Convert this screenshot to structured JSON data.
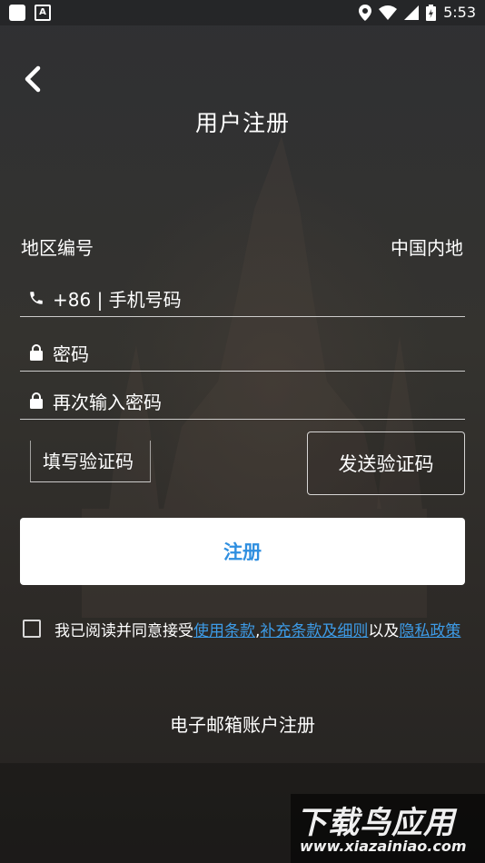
{
  "status_bar": {
    "time": "5:53",
    "icons": [
      "app-icon",
      "font-icon",
      "location-icon",
      "wifi-icon",
      "signal-icon",
      "battery-icon"
    ]
  },
  "header": {
    "title": "用户注册",
    "back_icon": "chevron-left-icon"
  },
  "region": {
    "label": "地区编号",
    "value": "中国内地"
  },
  "phone": {
    "icon": "phone-icon",
    "placeholder": "+86 | 手机号码"
  },
  "password": {
    "icon": "lock-icon",
    "placeholder": "密码"
  },
  "confirm_password": {
    "icon": "lock-icon",
    "placeholder": "再次输入密码"
  },
  "verification": {
    "placeholder": "填写验证码",
    "send_label": "发送验证码"
  },
  "register_button": {
    "label": "注册"
  },
  "agreement": {
    "prefix": "我已阅读并同意接受",
    "terms_link": "使用条款",
    "separator": ",",
    "supplement_link": "补充条款及细则",
    "and": "以及",
    "privacy_link": "隐私政策"
  },
  "email_register": {
    "label": "电子邮箱账户注册"
  },
  "watermark": {
    "title": "下载鸟应用",
    "url": "www.xiazainiao.com"
  },
  "colors": {
    "accent": "#2f8fe0",
    "link": "#3d9be6",
    "background": "#2b2b2b"
  }
}
